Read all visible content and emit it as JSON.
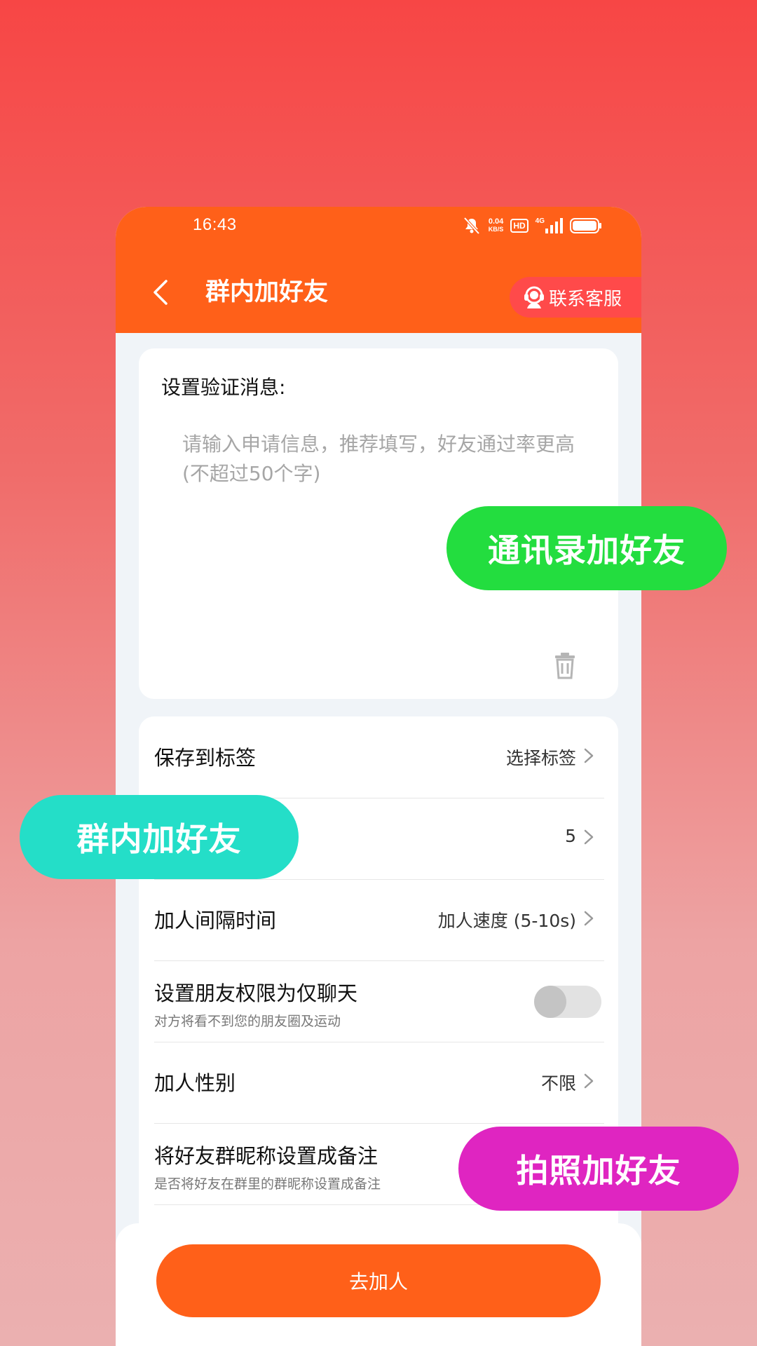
{
  "status_bar": {
    "time": "16:43",
    "speed_value": "0.04",
    "speed_unit": "KB/S",
    "hd_badge": "HD",
    "network_type": "4G"
  },
  "header": {
    "title": "群内加好友",
    "service_label": "联系客服"
  },
  "verify_card": {
    "title": "设置验证消息:",
    "placeholder": "请输入申请信息，推荐填写，好友通过率更高(不超过50个字)",
    "value": ""
  },
  "settings": {
    "save_to_tag": {
      "label": "保存到标签",
      "value": "选择标签"
    },
    "hidden_count": {
      "value": "5"
    },
    "interval": {
      "label": "加人间隔时间",
      "value": "加人速度 (5-10s)"
    },
    "chat_only": {
      "label": "设置朋友权限为仅聊天",
      "sub": "对方将看不到您的朋友圈及运动",
      "enabled": false
    },
    "gender": {
      "label": "加人性别",
      "value": "不限"
    },
    "group_nickname": {
      "label": "将好友群昵称设置成备注",
      "sub": "是否将好友在群里的群昵称设置成备注"
    }
  },
  "submit": {
    "label": "去加人"
  },
  "promo_pills": {
    "contacts": "通讯录加好友",
    "group": "群内加好友",
    "photo": "拍照加好友"
  },
  "colors": {
    "brand_orange": "#ff6019",
    "service_red": "#ff4a4a",
    "pill_green": "#23dd3f",
    "pill_teal": "#24dec8",
    "pill_magenta": "#df25c1"
  }
}
